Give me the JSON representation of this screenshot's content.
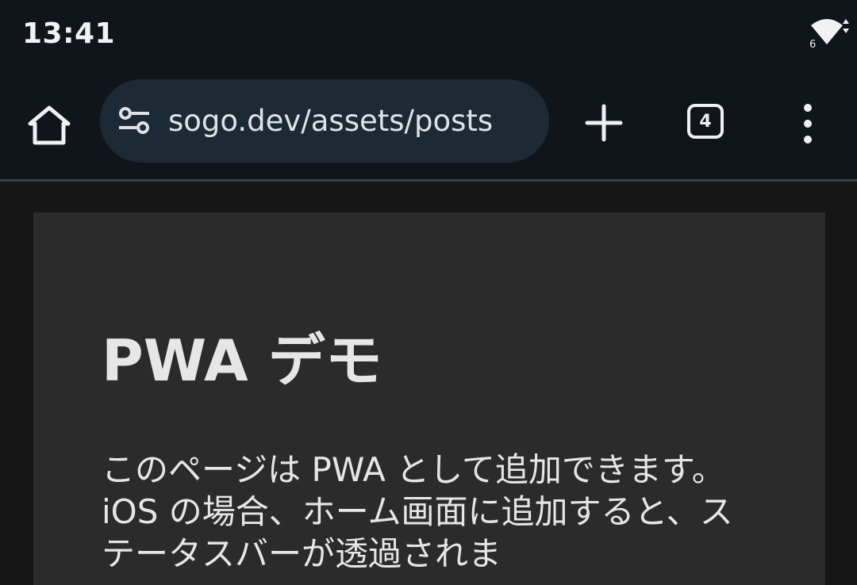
{
  "status_bar": {
    "time": "13:41",
    "wifi_icon": "wifi-icon",
    "battery_icon": "battery-icon"
  },
  "toolbar": {
    "home_icon": "home-icon",
    "site_settings_icon": "tune-icon",
    "url": "sogo.dev/assets/posts",
    "new_tab_icon": "plus-icon",
    "tab_count": "4",
    "menu_icon": "more-vert-icon"
  },
  "page": {
    "title": "PWA デモ",
    "body": "このページは PWA として追加できます。iOS の場合、ホーム画面に追加すると、ステータスバーが透過されま"
  },
  "colors": {
    "chrome_background": "#0f151b",
    "address_bar": "#1c2a35",
    "page_background": "#161616",
    "card_background": "#2b2b2b",
    "text": "#e6e6e6"
  }
}
